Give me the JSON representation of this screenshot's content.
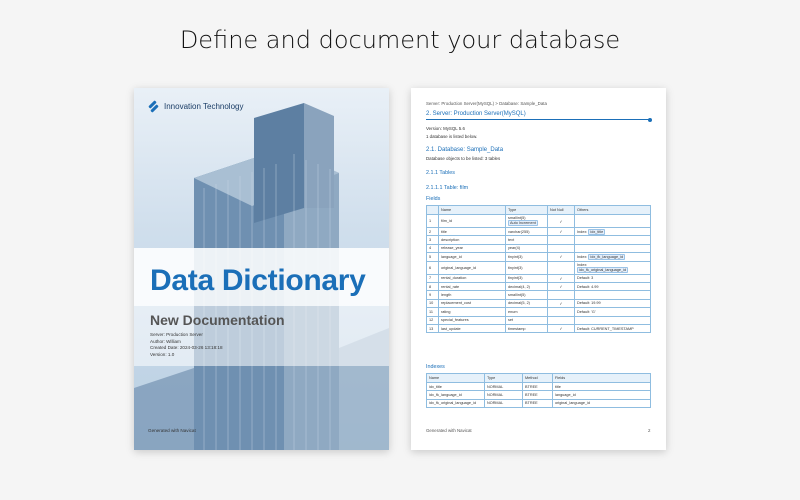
{
  "headline": "Define and document your database",
  "cover": {
    "company": "Innovation Technology",
    "title": "Data Dictionary",
    "subtitle": "New Documentation",
    "meta": [
      "Server: Production Server",
      "Author: William",
      "Created Date: 2024-03-26 13:18:18",
      "Version: 1.0"
    ],
    "generated": "Generated with Navicat"
  },
  "doc": {
    "breadcrumb": "Server: Production Server(MySQL) > Database: Sample_Data",
    "server_heading": "2.  Server: Production Server(MySQL)",
    "version": "Version: MySQL 5.6",
    "db_count": "1 database is listed below.",
    "db_heading": "2.1. Database: Sample_Data",
    "db_objects": "Database objects to be listed: 3 tables",
    "tables_heading": "2.1.1 Tables",
    "table_heading": "2.1.1.1 Table: film",
    "fields_label": "Fields",
    "fields_columns": [
      "",
      "Name",
      "Type",
      "Not Null",
      "Others"
    ],
    "fields_rows": [
      {
        "no": "1",
        "name": "film_id",
        "type": "smallint(5)",
        "type_extra": "Auto Increment",
        "notnull": "✓",
        "others": ""
      },
      {
        "no": "2",
        "name": "title",
        "type": "varchar(255)",
        "notnull": "✓",
        "others": "Index: ",
        "others_badge": "idx_title"
      },
      {
        "no": "3",
        "name": "description",
        "type": "text",
        "notnull": "",
        "others": ""
      },
      {
        "no": "4",
        "name": "release_year",
        "type": "year(4)",
        "notnull": "",
        "others": ""
      },
      {
        "no": "5",
        "name": "language_id",
        "type": "tinyint(3)",
        "notnull": "✓",
        "others": "Index: ",
        "others_badge": "idx_fk_language_id"
      },
      {
        "no": "6",
        "name": "original_language_id",
        "type": "tinyint(3)",
        "notnull": "",
        "others": "Index:",
        "others_badge2": "idx_fk_original_language_id"
      },
      {
        "no": "7",
        "name": "rental_duration",
        "type": "tinyint(3)",
        "notnull": "✓",
        "others": "Default: 3"
      },
      {
        "no": "8",
        "name": "rental_rate",
        "type": "decimal(4, 2)",
        "notnull": "✓",
        "others": "Default: 4.99"
      },
      {
        "no": "9",
        "name": "length",
        "type": "smallint(5)",
        "notnull": "",
        "others": ""
      },
      {
        "no": "10",
        "name": "replacement_cost",
        "type": "decimal(5, 2)",
        "notnull": "✓",
        "others": "Default: 19.99"
      },
      {
        "no": "11",
        "name": "rating",
        "type": "enum",
        "notnull": "",
        "others": "Default: 'G'"
      },
      {
        "no": "12",
        "name": "special_features",
        "type": "set",
        "notnull": "",
        "others": ""
      },
      {
        "no": "13",
        "name": "last_update",
        "type": "timestamp",
        "notnull": "✓",
        "others": "Default: CURRENT_TIMESTAMP"
      }
    ],
    "indexes_label": "Indexes",
    "indexes_columns": [
      "Name",
      "Type",
      "Method",
      "Fields"
    ],
    "indexes_rows": [
      [
        "idx_title",
        "NORMAL",
        "BTREE",
        "title"
      ],
      [
        "idx_fk_language_id",
        "NORMAL",
        "BTREE",
        "language_id"
      ],
      [
        "idx_fk_original_language_id",
        "NORMAL",
        "BTREE",
        "original_language_id"
      ]
    ],
    "footer_left": "Generated with Navicat",
    "footer_page": "2"
  },
  "colors": {
    "accent": "#1b6fb8",
    "table_border": "#8fbde0",
    "background": "#f5f5f5"
  }
}
